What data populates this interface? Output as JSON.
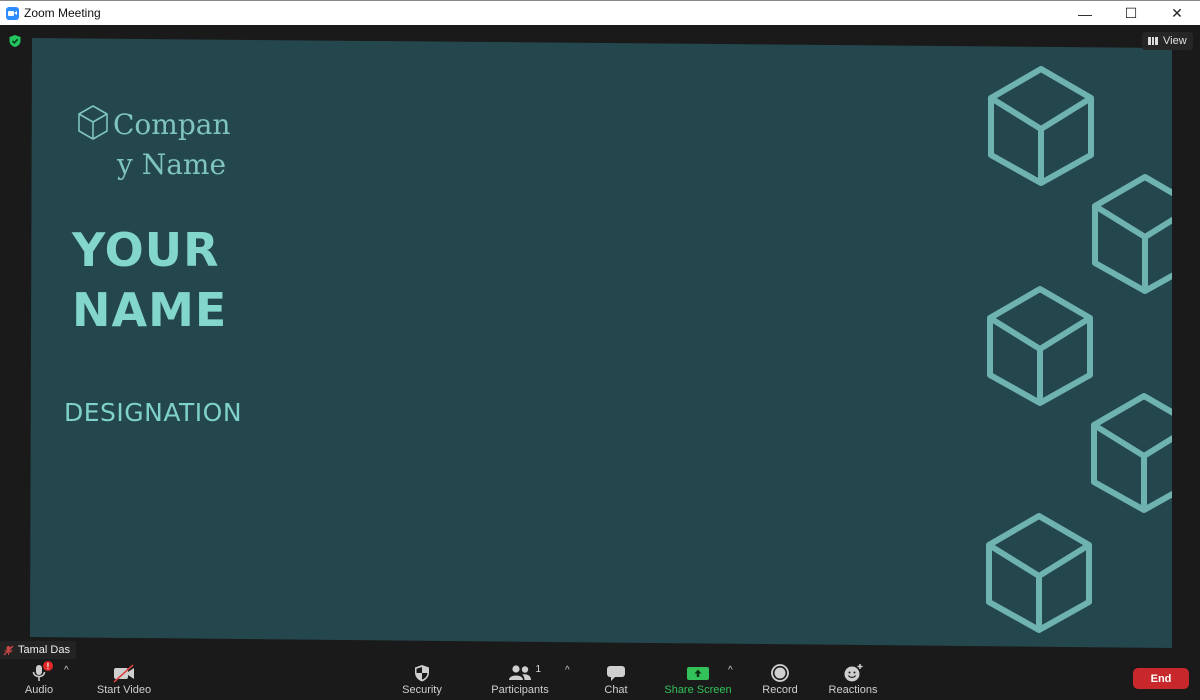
{
  "window": {
    "title": "Zoom Meeting",
    "controls": {
      "minimize": "—",
      "maximize": "☐",
      "close": "✕"
    }
  },
  "stage": {
    "view_label": "View",
    "encryption_icon": "shield-check-icon",
    "name_tag": "Tamal Das"
  },
  "slide": {
    "company_line1": "Compan",
    "company_line2": "y Name",
    "name_line1": "YOUR",
    "name_line2": "NAME",
    "designation": "DESIGNATION",
    "colors": {
      "background": "#24464d",
      "accent": "#7fd2c9",
      "cube": "#6fb3b0"
    }
  },
  "toolbar": {
    "audio": {
      "label": "Audio",
      "icon": "microphone-icon",
      "alert": "!"
    },
    "video": {
      "label": "Start Video",
      "icon": "video-off-icon"
    },
    "security": {
      "label": "Security",
      "icon": "shield-icon"
    },
    "participants": {
      "label": "Participants",
      "icon": "participants-icon",
      "count": "1"
    },
    "chat": {
      "label": "Chat",
      "icon": "chat-icon"
    },
    "share": {
      "label": "Share Screen",
      "icon": "share-arrow-icon",
      "color": "#33c159"
    },
    "record": {
      "label": "Record",
      "icon": "record-icon"
    },
    "reactions": {
      "label": "Reactions",
      "icon": "emoji-add-icon"
    },
    "end": {
      "label": "End",
      "color": "#c8282b"
    }
  }
}
